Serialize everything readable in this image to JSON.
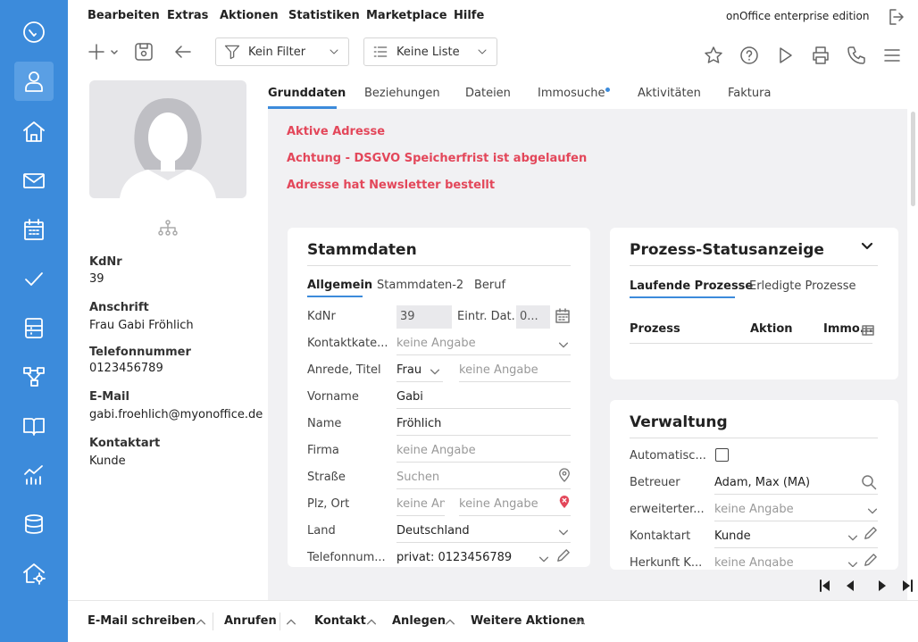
{
  "menu": [
    "Bearbeiten",
    "Extras",
    "Aktionen",
    "Statistiken",
    "Marketplace",
    "Hilfe"
  ],
  "brand": "onOffice enterprise edition",
  "toolbar": {
    "filter_label": "Kein Filter",
    "list_label": "Keine Liste"
  },
  "sidebar_icons": [
    "dashboard-icon",
    "address-icon",
    "property-icon",
    "email-icon",
    "calendar-icon",
    "tasks-icon",
    "file-icon",
    "process-icon",
    "book-icon",
    "statistics-icon",
    "database-icon",
    "admin-icon"
  ],
  "left": {
    "kdnr_label": "KdNr",
    "kdnr_value": "39",
    "anschrift_label": "Anschrift",
    "anschrift_value": "Frau Gabi Fröhlich",
    "tel_label": "Telefonnummer",
    "tel_value": "0123456789",
    "email_label": "E-Mail",
    "email_value": "gabi.froehlich@myonoffice.de",
    "kontaktart_label": "Kontaktart",
    "kontaktart_value": "Kunde"
  },
  "tabs": [
    "Grunddaten",
    "Beziehungen",
    "Dateien",
    "Immosuche",
    "Aktivitäten",
    "Faktura"
  ],
  "alerts": [
    "Aktive Adresse",
    "Achtung - DSGVO Speicherfrist ist abgelaufen",
    "Adresse hat Newsletter bestellt"
  ],
  "stammdaten": {
    "title": "Stammdaten",
    "subtabs": [
      "Allgemein",
      "Stammdaten-2",
      "Beruf"
    ],
    "fields": {
      "kdnr_label": "KdNr",
      "kdnr_value": "39",
      "eintr_label": "Eintr. Dat.",
      "eintr_value": "0...",
      "kontakt_label": "Kontaktkate...",
      "kontakt_ph": "keine Angabe",
      "anrede_label": "Anrede, Titel",
      "anrede_value": "Frau",
      "titel_ph": "keine Angabe",
      "vorname_label": "Vorname",
      "vorname_value": "Gabi",
      "name_label": "Name",
      "name_value": "Fröhlich",
      "firma_label": "Firma",
      "firma_ph": "keine Angabe",
      "strasse_label": "Straße",
      "strasse_ph": "Suchen",
      "plz_label": "Plz, Ort",
      "plz_ph": "keine An",
      "ort_ph": "keine Angabe",
      "land_label": "Land",
      "land_value": "Deutschland",
      "telefon_label": "Telefonnum...",
      "telefon_value": "privat: 0123456789"
    }
  },
  "prozess": {
    "title": "Prozess-Statusanzeige",
    "subtabs": [
      "Laufende Prozesse",
      "Erledigte Prozesse"
    ],
    "columns": [
      "Prozess",
      "Aktion",
      "Immo..."
    ]
  },
  "verwaltung": {
    "title": "Verwaltung",
    "auto_label": "Automatisc...",
    "betreuer_label": "Betreuer",
    "betreuer_value": "Adam, Max (MA)",
    "erw_label": "erweiterter...",
    "erw_ph": "keine Angabe",
    "kontaktart_label": "Kontaktart",
    "kontaktart_value": "Kunde",
    "herkunft_label": "Herkunft K...",
    "herkunft_ph": "keine Angabe"
  },
  "bottom_actions": [
    "E-Mail schreiben",
    "Anrufen",
    "Kontakt",
    "Anlegen",
    "Weitere Aktionen"
  ],
  "colors": {
    "sidebar": "#3c8bdb",
    "accent": "#3c8bdb",
    "alert": "#e3475a",
    "content_bg": "#f1f1f3"
  }
}
